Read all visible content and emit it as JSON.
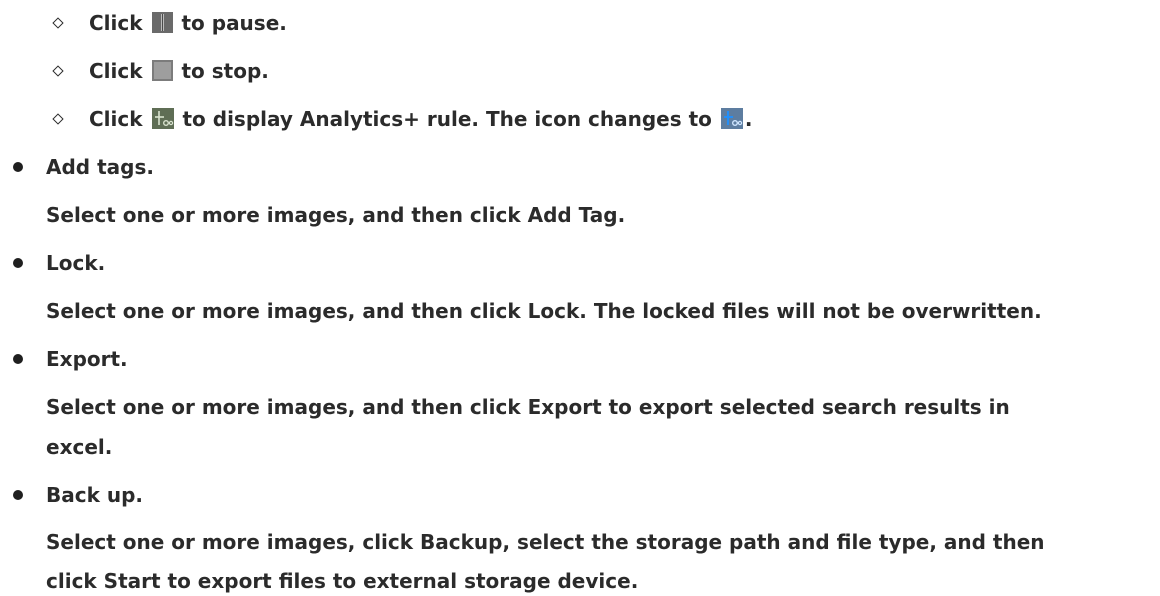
{
  "sub_items": [
    {
      "before": "Click",
      "icon": "pause-icon",
      "after": "to pause."
    },
    {
      "before": "Click",
      "icon": "stop-icon",
      "after": "to stop."
    },
    {
      "before": "Click",
      "icon": "analytics-rule-icon",
      "middle": "to display Analytics+ rule. The icon changes to",
      "icon2": "analytics-rule-active-icon",
      "after": "."
    }
  ],
  "items": [
    {
      "title": "Add tags.",
      "lines": [
        "Select one or more images, and then click Add Tag."
      ]
    },
    {
      "title": "Lock.",
      "lines": [
        "Select one or more images, and then click Lock. The locked files will not be overwritten."
      ]
    },
    {
      "title": "Export.",
      "lines": [
        "Select one or more images, and then click Export to export selected search results in",
        "excel."
      ]
    },
    {
      "title": "Back up.",
      "lines": [
        "Select one or more images, click Backup, select the storage path and file type, and then",
        "click Start to export files to external storage device."
      ]
    }
  ],
  "colors": {
    "text": "#2b2b2b",
    "icon_active": "#1e88e5",
    "icon_inactive": "#6d7b60"
  }
}
